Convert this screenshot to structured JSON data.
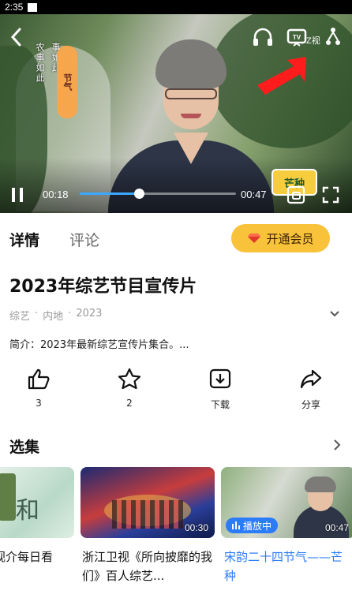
{
  "status_bar": {
    "time": "2:35"
  },
  "player": {
    "current_time": "00:18",
    "total_time": "00:47",
    "progress": 0.38,
    "tv_label": "Z视",
    "overlay_vertical_1": "农事如此",
    "overlay_vertical_2": "事如此",
    "badge_left": "节气",
    "badge_right": "芒种",
    "accent_color": "#3ba8ff"
  },
  "tabs": {
    "details": "详情",
    "comments": "评论"
  },
  "vip_button": {
    "label": "开通会员",
    "color": "#f8c23a"
  },
  "video": {
    "title": "2023年综艺节目宣传片",
    "meta": [
      "综艺",
      "·",
      "内地",
      "·",
      "2023"
    ],
    "intro": "简介：2023年最新综艺宣传片集合。..."
  },
  "actions": {
    "like": {
      "icon": "thumbs-up-icon",
      "label": "3"
    },
    "favorite": {
      "icon": "star-icon",
      "label": "2"
    },
    "download": {
      "icon": "download-icon",
      "label": "下载"
    },
    "share": {
      "icon": "share-icon",
      "label": "分享"
    }
  },
  "episodes": {
    "heading": "选集",
    "items": [
      {
        "title": "视介每日看",
        "duration": "",
        "playing": false
      },
      {
        "title": "浙江卫视《所向披靡的我们》百人综艺...",
        "duration": "00:30",
        "playing": false
      },
      {
        "title": "宋韵二十四节气——芒种",
        "duration": "00:47",
        "playing": true
      }
    ],
    "playing_label": "播放中",
    "playing_color": "#2b7cf6"
  }
}
